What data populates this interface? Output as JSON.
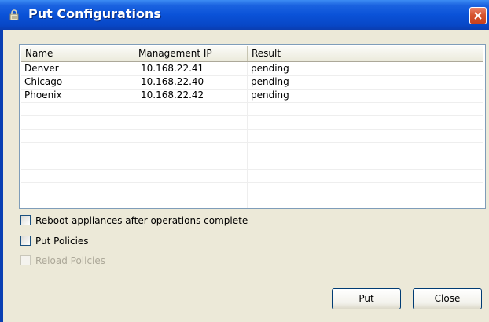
{
  "window": {
    "title": "Put Configurations",
    "icon": "lock-icon",
    "close_icon": "close-icon"
  },
  "table": {
    "columns": [
      "Name",
      "Management IP",
      "Result"
    ],
    "rows": [
      {
        "name": "Denver",
        "ip": "10.168.22.41",
        "result": "pending"
      },
      {
        "name": "Chicago",
        "ip": "10.168.22.40",
        "result": "pending"
      },
      {
        "name": "Phoenix",
        "ip": "10.168.22.42",
        "result": "pending"
      }
    ]
  },
  "options": {
    "reboot": {
      "label": "Reboot appliances after operations complete",
      "checked": false,
      "enabled": true
    },
    "put_policies": {
      "label": "Put Policies",
      "checked": false,
      "enabled": true
    },
    "reload_policies": {
      "label": "Reload Policies",
      "checked": false,
      "enabled": false
    }
  },
  "buttons": {
    "put": "Put",
    "close": "Close"
  },
  "colors": {
    "titlebar": "#0a52d8",
    "close": "#d6552f",
    "dialog_bg": "#ece9d8",
    "grid_border": "#7f9db9"
  }
}
